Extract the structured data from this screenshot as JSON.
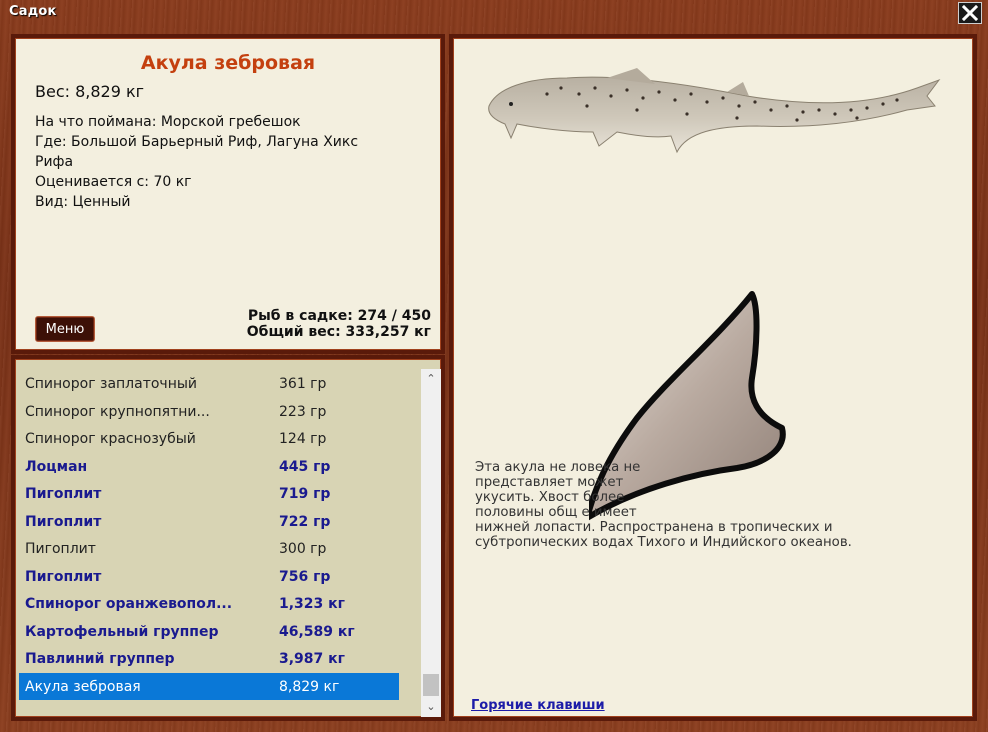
{
  "window": {
    "title": "Садок"
  },
  "info": {
    "fish_name": "Акула зебровая",
    "weight": "Вес: 8,829 кг",
    "bait": "На что поймана: Морской гребешок",
    "location_line1": "Где: Большой Барьерный Риф, Лагуна Хикс",
    "location_line2": "Рифа",
    "valued_from": "Оценивается с: 70 кг",
    "kind": "Вид: Ценный",
    "menu_label": "Меню",
    "fish_in_keep": "Рыб в садке: 274 / 450",
    "total_weight": "Общий вес: 333,257 кг"
  },
  "list": {
    "rows": [
      {
        "name": "Спинорог заплаточный",
        "weight": "361 гр",
        "bold": false,
        "selected": false
      },
      {
        "name": "Спинорог крупнопятни...",
        "weight": "223 гр",
        "bold": false,
        "selected": false
      },
      {
        "name": "Спинорог краснозубый",
        "weight": "124 гр",
        "bold": false,
        "selected": false
      },
      {
        "name": "Лоцман",
        "weight": "445 гр",
        "bold": true,
        "selected": false
      },
      {
        "name": "Пигоплит",
        "weight": "719 гр",
        "bold": true,
        "selected": false
      },
      {
        "name": "Пигоплит",
        "weight": "722 гр",
        "bold": true,
        "selected": false
      },
      {
        "name": "Пигоплит",
        "weight": "300 гр",
        "bold": false,
        "selected": false
      },
      {
        "name": "Пигоплит",
        "weight": "756 гр",
        "bold": true,
        "selected": false
      },
      {
        "name": "Спинорог оранжевопол...",
        "weight": "1,323 кг",
        "bold": true,
        "selected": false
      },
      {
        "name": "Картофельный группер",
        "weight": "46,589 кг",
        "bold": true,
        "selected": false
      },
      {
        "name": "Павлиний группер",
        "weight": "3,987 кг",
        "bold": true,
        "selected": false
      },
      {
        "name": "Акула зебровая",
        "weight": "8,829 кг",
        "bold": false,
        "selected": true
      }
    ],
    "scroll_position": 0.95
  },
  "detail": {
    "description_lines": [
      "Эта акула не                                                       ловека не",
      "представляет                                                      может",
      "укусить. Хвост                                                      более",
      "половины общ                                                     е имеет",
      "нижней лопасти. Распространена в тропических и",
      "субтропических водах Тихого и Индийского океанов."
    ],
    "hotkeys_link": "Горячие клавиши"
  },
  "icons": {
    "close": "close-icon",
    "scroll_up": "chevron-up-icon",
    "scroll_down": "chevron-down-icon",
    "tooth": "shark-tooth-icon"
  },
  "colors": {
    "title": "#c4400f",
    "bold_row": "#1a1a8f",
    "selected_row": "#0a78d7",
    "link": "#1c1ca8"
  }
}
